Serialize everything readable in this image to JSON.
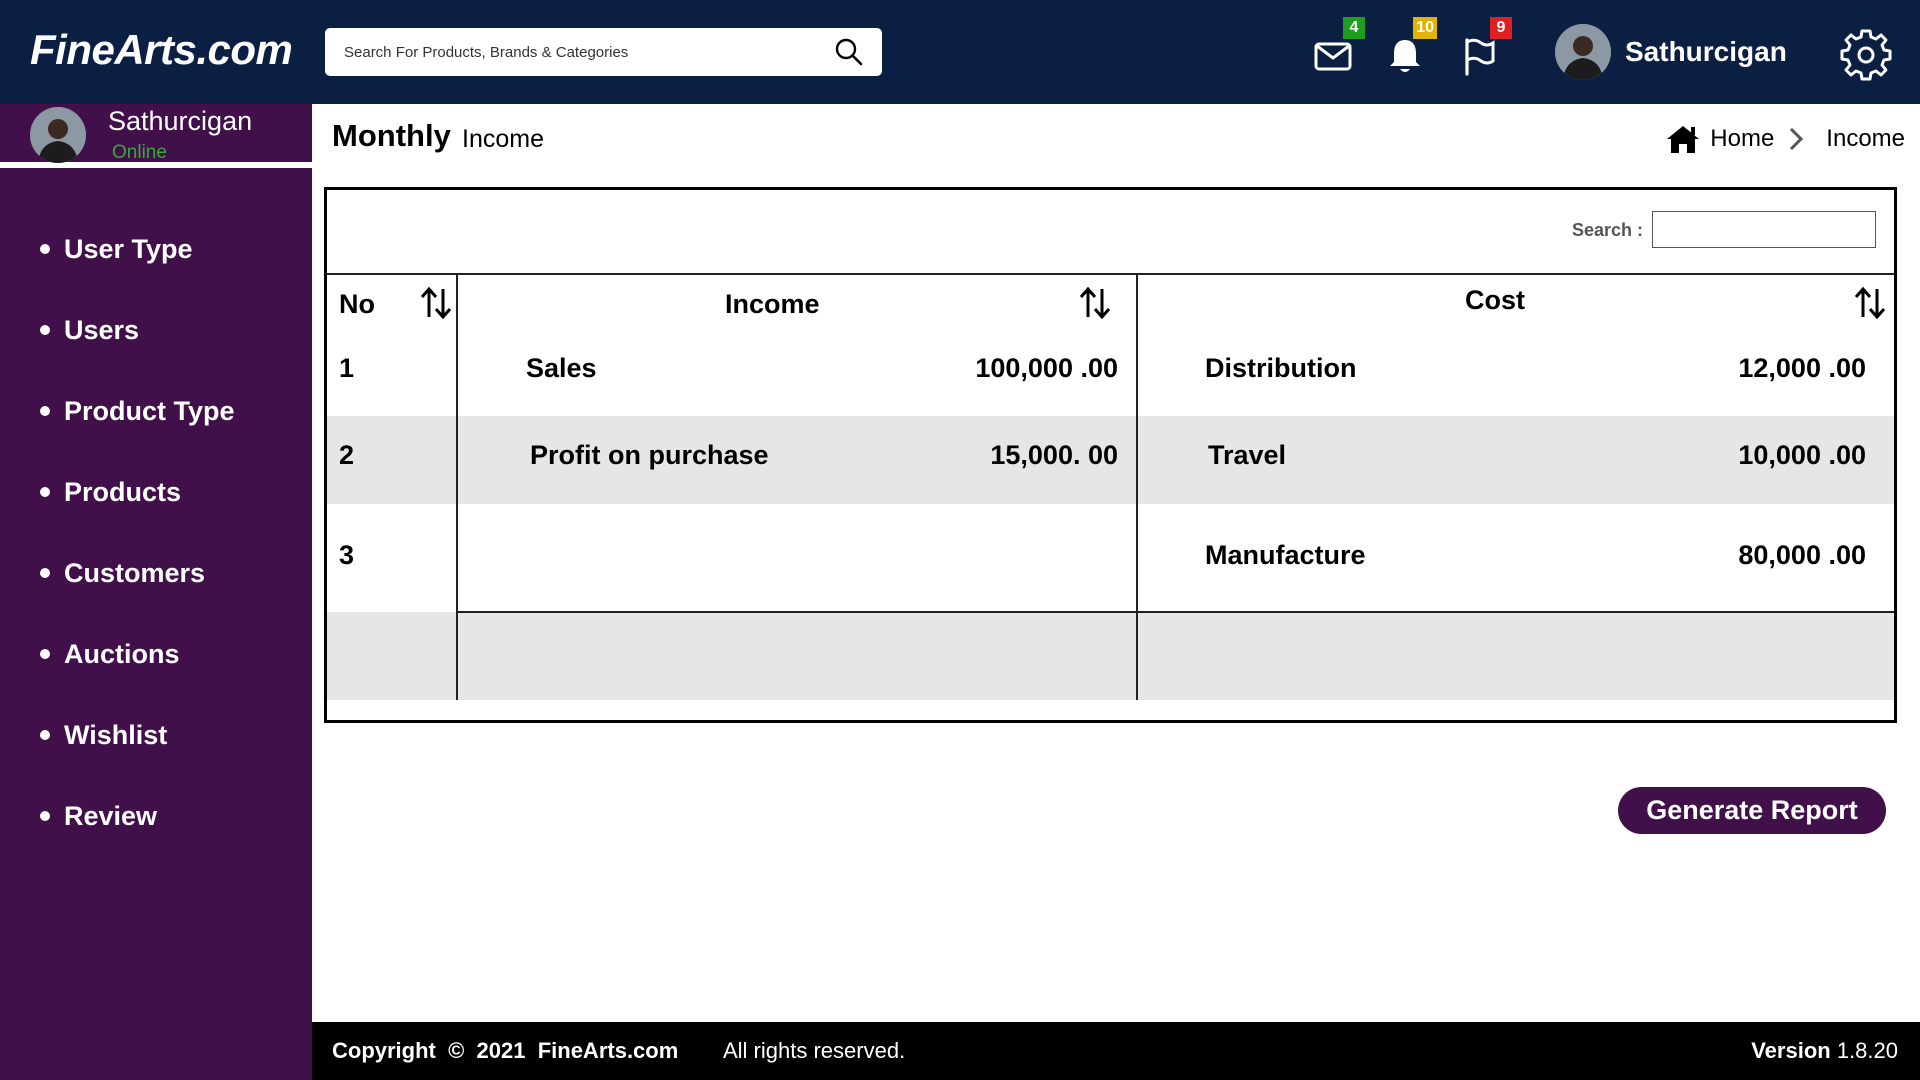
{
  "header": {
    "logo": "FineArts.com",
    "search_placeholder": "Search For Products, Brands & Categories",
    "badges": {
      "mail": "4",
      "notifications": "10",
      "flags": "9"
    },
    "badge_colors": {
      "mail": "#1e9e1e",
      "notifications": "#e0b400",
      "flags": "#e02020"
    },
    "user_name": "Sathurcigan"
  },
  "sidebar": {
    "user_name": "Sathurcigan",
    "status": "Online",
    "items": [
      {
        "label": "User Type"
      },
      {
        "label": "Users"
      },
      {
        "label": "Product Type"
      },
      {
        "label": "Products"
      },
      {
        "label": "Customers"
      },
      {
        "label": "Auctions"
      },
      {
        "label": "Wishlist"
      },
      {
        "label": "Review"
      }
    ]
  },
  "page": {
    "title": "Monthly",
    "subtitle": "Income",
    "breadcrumb": {
      "home": "Home",
      "current": "Income"
    }
  },
  "table": {
    "search_label": "Search :",
    "headers": {
      "no": "No",
      "income": "Income",
      "cost": "Cost"
    },
    "rows": [
      {
        "no": "1",
        "income_label": "Sales",
        "income_amount": "100,000 .00",
        "cost_label": "Distribution",
        "cost_amount": "12,000 .00"
      },
      {
        "no": "2",
        "income_label": "Profit on purchase",
        "income_amount": "15,000. 00",
        "cost_label": "Travel",
        "cost_amount": "10,000 .00"
      },
      {
        "no": "3",
        "income_label": "",
        "income_amount": "",
        "cost_label": "Manufacture",
        "cost_amount": "80,000 .00"
      }
    ]
  },
  "actions": {
    "generate_report": "Generate Report"
  },
  "footer": {
    "copyright": "Copyright  ©  2021  FineArts.com",
    "rights": "All rights reserved.",
    "version_label": "Version",
    "version": "1.8.20"
  },
  "colors": {
    "topbar": "#0b1f42",
    "sidebar": "#41104a",
    "online": "#3ba83b"
  }
}
